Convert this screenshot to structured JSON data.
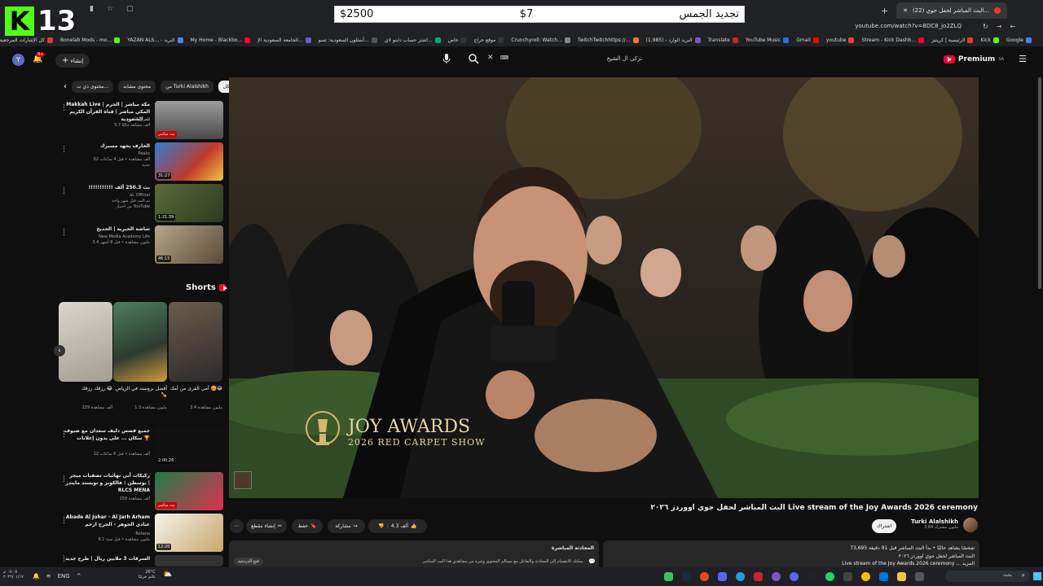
{
  "browser": {
    "tab_title": "(22) البث المباشر لحفل جوي...",
    "url": "youtube.com/watch?v=8DC8_jo2ZLQ",
    "bookmarks": [
      "Google",
      "Kick",
      "الرئيسية | كريتيز",
      "Stream - Kick Dashb...",
      "youtube",
      "Gmail",
      "YouTube Music",
      "Translate",
      "البريد الوارد - (1,985)",
      "TwitchTwitchhttps://...",
      "Crunchyroll: Watch...",
      "موقع حراج",
      "خاص",
      "اشتر حساب دايتو لاي...",
      "أسئلون السعودية: تسو...",
      "الجامعة السعودية الإ...",
      "My Home - Blackbo...",
      "YAZAN ALS... - البريد",
      "Bonelab Mods - mo...",
      "كل الإشارات المرجعية"
    ]
  },
  "overlay": {
    "logo_letter": "K",
    "logo_number": "13",
    "banner_left": "$2500",
    "banner_mid": "$7",
    "banner_right": "تجديد الجمس"
  },
  "youtube": {
    "logo": "Premium",
    "logo_sup": "SA",
    "search_value": "تركي ال الشيخ",
    "create_label": "إنشاء",
    "notif_count": "9+",
    "avatar_letter": "Y",
    "chips": [
      "الكل",
      "من Turki Alalshikh",
      "محتوى مشابه",
      "محتوى ذي ت..."
    ],
    "recommendations": [
      {
        "title": "Makkah Live | مكة مباشر | الحرم المكي مباشر | قناة القرآن الكريم السعودية ...",
        "channel": "القرآن الكريم",
        "meta": "5.7 ألف مشاهد حاليًا",
        "badge": "بث مباشر"
      },
      {
        "title": "الخارف يجهد مسيرك",
        "channel": "Peaks",
        "meta": "62 ألف مشاهدة • قبل 4 ساعات",
        "badge": "31:27",
        "tag": "جديد"
      },
      {
        "title": "!!!!!!!!!!! بث 250.3 ألف",
        "channel": "aL Official",
        "meta": "تم البث قبل شهر واحد",
        "badge": "1:21:39",
        "extra": "من اختيار YouTube"
      },
      {
        "title": "شاشة الخبرية | الحديح",
        "channel": "New Media Academy Life",
        "meta": "3.4 مليون مشاهدة • قبل 8 أشهر",
        "badge": "46:15"
      }
    ],
    "shorts_heading": "Shorts",
    "shorts": [
      {
        "title": "أمي القرى من أمك 🥰😂",
        "views": "3.4 مليون مشاهدة"
      },
      {
        "title": "أفضل بروستد في الرياض 🍗",
        "views": "1.3 مليون مشاهدة"
      },
      {
        "title": "رزقك رزقك 😂",
        "views": "229 ألف مشاهدة"
      }
    ],
    "more_recommendations": [
      {
        "title": "جميع قصص دليف سعدان مع ضيوف سكان ... على بدون إعلانات 🏆",
        "meta": "12 ألف مشاهدة • قبل 6 ساعات",
        "badge": "2:00:26"
      },
      {
        "title": "ركيكات أبي نهائيات تصفيات ميجر بوسطن : فالكونز و تويستد مايندز | RLCS MENA",
        "meta": "159 ألف مشاهدة",
        "badge": "بث مباشر"
      },
      {
        "title": "Abade Al Johar - Al Jarh Arham عبادي الجوهر - الجرح ارحم",
        "channel": "Rotana",
        "meta": "6.1 مليون مشاهدة • قبل سنة",
        "badge": "12:20"
      },
      {
        "title": "السرقات 3 ملايين ريال | طرح جديد",
        "meta": "",
        "badge": ""
      }
    ],
    "video": {
      "overlay_title": "JOY AWARDS",
      "overlay_sub": "2026 RED CARPET SHOW",
      "title": "البث المباشر لحفل جوي اووردز ٢٠٢٦ Live stream of the Joy Awards 2026 ceremony",
      "channel": "Turki Alalshikh",
      "subscribers": "3.64 مليون مشترك",
      "subscribed_label": "اشتراك",
      "likes": "4.3 ألف",
      "share": "مشاركة",
      "save": "حفظ",
      "clip": "إنشاء مقطع",
      "watching": "73,695 شخصًا يشاهد حاليًا • بدأ البث المباشر قبل 91 دقيقة",
      "desc_line": "البث المباشر لحفل جوي اووردز ٢٠٢٦",
      "desc_line2": "Live stream of the Joy Awards 2026 ceremony ... المزيد",
      "chat_title": "المحادثة المباشرة",
      "chat_text": "بمكنك الانضمام إلى المحادثة والتفاعل مع مسالم المحتوى وغيره من مشاهدي هذا البث المباشر.",
      "chat_open": "فتح الدردشة"
    }
  },
  "taskbar": {
    "search": "بحث",
    "weather": "26°C",
    "weather_desc": "غائم جزئيًا",
    "time": "٠٧:٠٥ م",
    "date": "٢٠٢٦/٠١/١٧",
    "lang": "ENG"
  },
  "colors": {
    "kick_green": "#53fc18",
    "youtube_red": "#ff0033",
    "bg": "#0f0f0f"
  }
}
